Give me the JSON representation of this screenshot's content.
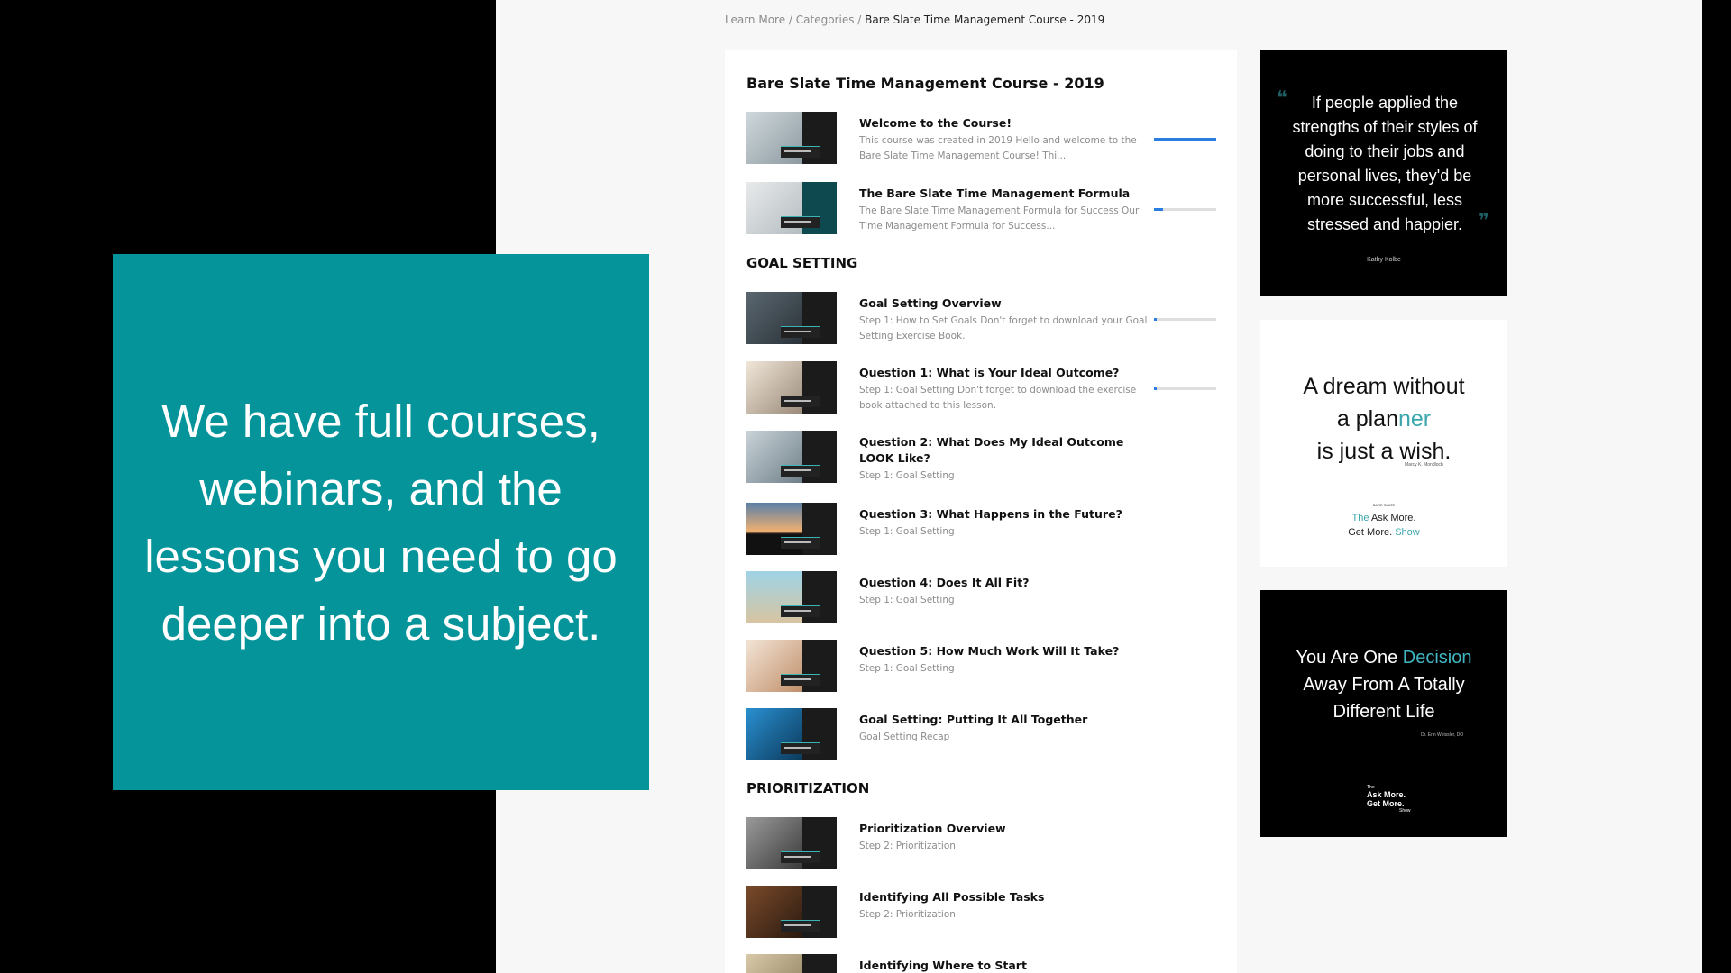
{
  "promo": {
    "text": "We have full courses, webinars, and the lessons you need to go deeper into a subject."
  },
  "breadcrumb": {
    "item1": "Learn More",
    "sep1": " / ",
    "item2": "Categories",
    "sep2": " / ",
    "current": "Bare Slate Time Management Course - 2019"
  },
  "course": {
    "title": "Bare Slate Time Management Course - 2019",
    "sections": [
      "GOAL SETTING",
      "PRIORITIZATION"
    ],
    "lessons": [
      {
        "title": "Welcome to the Course!",
        "desc": "This course was created in 2019 Hello and welcome to the Bare Slate Time Management Course! Thi...",
        "progress": 100
      },
      {
        "title": "The Bare Slate Time Management Formula",
        "desc": "The Bare Slate Time Management Formula for Success  Our Time Management Formula for Success...",
        "progress": 15
      },
      {
        "title": "Goal Setting Overview",
        "desc": "Step 1: How to Set Goals Don't forget to download your Goal Setting Exercise Book.",
        "progress": 4
      },
      {
        "title": "Question 1: What is Your Ideal Outcome?",
        "desc": "Step 1: Goal Setting Don't forget to download the exercise book attached to this lesson.",
        "progress": 4
      },
      {
        "title": "Question 2: What Does My Ideal Outcome LOOK Like?",
        "desc": "Step 1: Goal Setting"
      },
      {
        "title": "Question 3: What Happens in the Future?",
        "desc": "Step 1: Goal Setting"
      },
      {
        "title": "Question 4: Does It All Fit?",
        "desc": "Step 1: Goal Setting"
      },
      {
        "title": "Question 5: How Much Work Will It Take?",
        "desc": "Step 1: Goal Setting"
      },
      {
        "title": "Goal Setting: Putting It All Together",
        "desc": "Goal Setting Recap"
      },
      {
        "title": "Prioritization Overview",
        "desc": "Step 2: Prioritization"
      },
      {
        "title": "Identifying All Possible Tasks",
        "desc": "Step 2: Prioritization"
      },
      {
        "title": "Identifying Where to Start",
        "desc": ""
      }
    ]
  },
  "quotes": {
    "q1": {
      "text": "If people applied the strengths of their styles of doing to their jobs and personal lives, they'd be more successful, less stressed and happier.",
      "author": "Kathy Kolbe",
      "open_mark": "❝",
      "close_mark": "❞"
    },
    "q2": {
      "line1": "A dream without",
      "line2_a": "a plan",
      "line2_b": "ner",
      "line3": "is just a wish.",
      "author": "Marcy K. Mondloch",
      "brand_small": "BARE SLATE",
      "brand_line1_a": "The",
      "brand_line1_b": " Ask More.",
      "brand_line2_a": "Get More. ",
      "brand_line2_b": "Show"
    },
    "q3": {
      "line1_a": "You Are One ",
      "line1_b": "Decision",
      "line2": "Away From A Totally",
      "line3": "Different Life",
      "author": "Dr. Erin Weissler, DO",
      "brand_top": "The",
      "brand_main1": "Ask More.",
      "brand_main2": "Get More.",
      "brand_bottom": "Show"
    }
  },
  "colors": {
    "accent": "#05949a",
    "progress": "#2a7de1",
    "teal_text": "#3ba7ab"
  }
}
